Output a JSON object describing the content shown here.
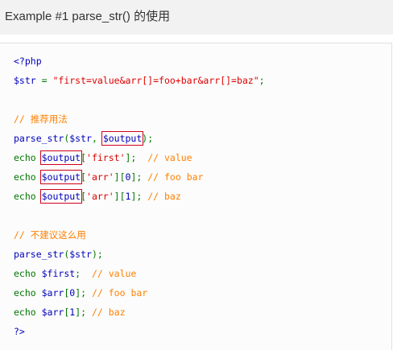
{
  "header": {
    "title": "Example #1 parse_str() 的使用"
  },
  "code": {
    "l1": {
      "open": "<?php"
    },
    "l2": {
      "var": "$str",
      "eq": " = ",
      "str": "\"first=value&arr[]=foo+bar&arr[]=baz\"",
      "semi": ";"
    },
    "l3": {
      "comment": "// 推荐用法"
    },
    "l4": {
      "fn": "parse_str",
      "p1": "(",
      "arg1": "$str",
      "comma": ", ",
      "arg2": "$output",
      "p2": ");"
    },
    "l5": {
      "echo": "echo ",
      "var": "$output",
      "b1": "[",
      "key": "'first'",
      "b2": "];  ",
      "comment": "// value"
    },
    "l6": {
      "echo": "echo ",
      "var": "$output",
      "b1": "[",
      "key": "'arr'",
      "b2": "][",
      "idx": "0",
      "b3": "]; ",
      "comment": "// foo bar"
    },
    "l7": {
      "echo": "echo ",
      "var": "$output",
      "b1": "[",
      "key": "'arr'",
      "b2": "][",
      "idx": "1",
      "b3": "]; ",
      "comment": "// baz"
    },
    "l8": {
      "comment": "// 不建议这么用"
    },
    "l9": {
      "fn": "parse_str",
      "p1": "(",
      "arg": "$str",
      "p2": ");"
    },
    "l10": {
      "echo": "echo ",
      "var": "$first",
      "semi": ";  ",
      "comment": "// value"
    },
    "l11": {
      "echo": "echo ",
      "var": "$arr",
      "b1": "[",
      "idx": "0",
      "b2": "]; ",
      "comment": "// foo bar"
    },
    "l12": {
      "echo": "echo ",
      "var": "$arr",
      "b1": "[",
      "idx": "1",
      "b2": "]; ",
      "comment": "// baz"
    },
    "l13": {
      "close": "?>"
    }
  },
  "colors": {
    "keyword": "#007700",
    "variable": "#0000bb",
    "string": "#dd0000",
    "comment": "#ff8000",
    "highlight_box": "#d0021b"
  }
}
